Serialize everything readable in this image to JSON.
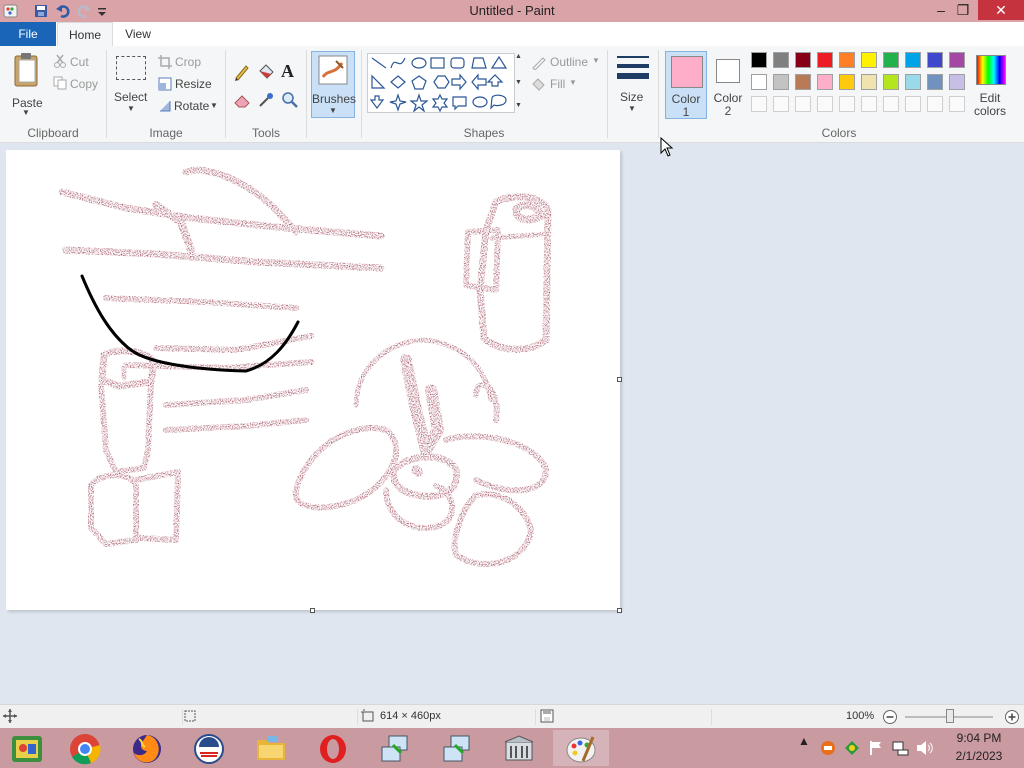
{
  "window": {
    "title": "Untitled - Paint",
    "controls": {
      "minimize": "–",
      "maximize": "❐",
      "close": "✕"
    }
  },
  "tabs": [
    {
      "label": "File"
    },
    {
      "label": "Home"
    },
    {
      "label": "View"
    }
  ],
  "ribbon": {
    "clipboard": {
      "paste": "Paste",
      "cut": "Cut",
      "copy": "Copy",
      "group": "Clipboard"
    },
    "image": {
      "select": "Select",
      "crop": "Crop",
      "resize": "Resize",
      "rotate": "Rotate",
      "group": "Image"
    },
    "tools": {
      "group": "Tools",
      "text_tool_glyph": "A"
    },
    "brushes": {
      "label": "Brushes"
    },
    "shapes": {
      "outline": "Outline",
      "fill": "Fill",
      "group": "Shapes"
    },
    "size": {
      "label": "Size"
    },
    "colors": {
      "color1_line1": "Color",
      "color1_line2": "1",
      "color1_value": "#ffaec9",
      "color2_line1": "Color",
      "color2_line2": "2",
      "color2_value": "#ffffff",
      "edit_line1": "Edit",
      "edit_line2": "colors",
      "group": "Colors",
      "palette_row1": [
        "#000000",
        "#7f7f7f",
        "#880015",
        "#ed1c24",
        "#ff7f27",
        "#fff200",
        "#22b14c",
        "#00a2e8",
        "#3f48cc",
        "#a349a4"
      ],
      "palette_row2": [
        "#ffffff",
        "#c3c3c3",
        "#b97a57",
        "#ffaec9",
        "#ffc90e",
        "#efe4b0",
        "#b5e61d",
        "#99d9ea",
        "#7092be",
        "#c8bfe7"
      ]
    }
  },
  "drawing": {
    "brush_color": "#7e0f23",
    "line_color": "#000000"
  },
  "status": {
    "canvas_size": "614 × 460px",
    "zoom": "100%"
  },
  "taskbar": {
    "apps": [
      "paint-app",
      "chrome",
      "firefox",
      "obama-app",
      "file-explorer",
      "opera",
      "network-app-1",
      "network-app-2",
      "library-app",
      "paint-active"
    ],
    "time": "9:04 PM",
    "date": "2/1/2023"
  }
}
